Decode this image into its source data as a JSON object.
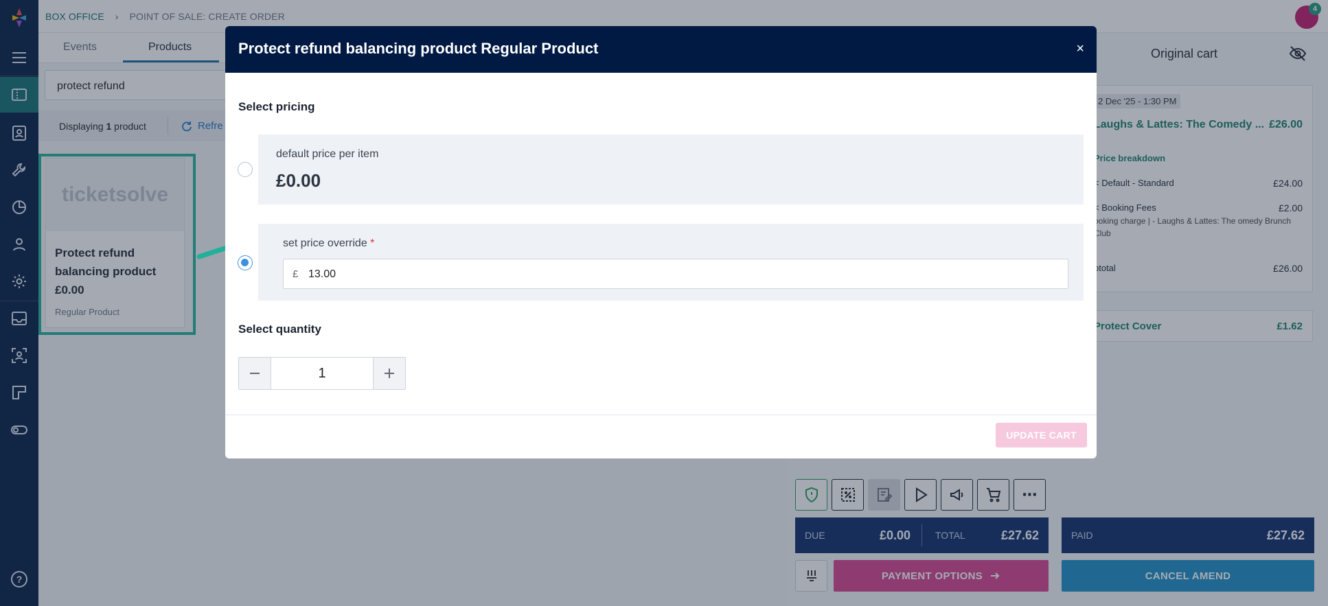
{
  "header": {
    "breadcrumb_root": "BOX OFFICE",
    "breadcrumb_current": "POINT OF SALE: CREATE ORDER",
    "notification_count": "4"
  },
  "tabs": [
    {
      "label": "Events"
    },
    {
      "label": "Products"
    }
  ],
  "search": {
    "value": "protect refund"
  },
  "results": {
    "prefix": "Displaying",
    "count": "1",
    "suffix": "product",
    "refresh_label": "Refre"
  },
  "product_card": {
    "image_text": "ticketsolve",
    "name": "Protect refund balancing product £0.00",
    "type": "Regular Product"
  },
  "cart": {
    "title": "Original cart",
    "date": "2 Dec '25 - 1:30 PM",
    "event": "Laughs & Lattes: The Comedy ...",
    "event_price": "£26.00",
    "breakdown_label": "Price breakdown",
    "line1_label": "< Default - Standard",
    "line1_amount": "£24.00",
    "line2_label": "< Booking Fees",
    "line2_amount": "£2.00",
    "line2_sub": "ooking charge | - Laughs & Lattes: The omedy Brunch Club",
    "subtotal_label": "btotal",
    "subtotal_amount": "£26.00",
    "cover_label": "Protect Cover",
    "cover_amount": "£1.62"
  },
  "totals": {
    "due_label": "DUE",
    "due_value": "£0.00",
    "total_label": "TOTAL",
    "total_value": "£27.62",
    "paid_label": "PAID",
    "paid_value": "£27.62"
  },
  "buttons": {
    "payment_options": "PAYMENT OPTIONS",
    "cancel_amend": "CANCEL AMEND",
    "more": "⋯"
  },
  "modal": {
    "title": "Protect refund balancing product Regular Product",
    "close": "×",
    "pricing_heading": "Select pricing",
    "default_label": "default price per item",
    "default_price": "£0.00",
    "override_label": "set price override",
    "required_mark": "*",
    "currency_symbol": "£",
    "override_value": "13.00",
    "quantity_heading": "Select quantity",
    "quantity": "1",
    "update_button": "UPDATE CART",
    "selected_option": "override"
  },
  "colors": {
    "navy": "#001a44",
    "teal": "#106f73",
    "highlight": "#21b09a",
    "pink": "#d6408f",
    "blue": "#1a8dc7"
  }
}
